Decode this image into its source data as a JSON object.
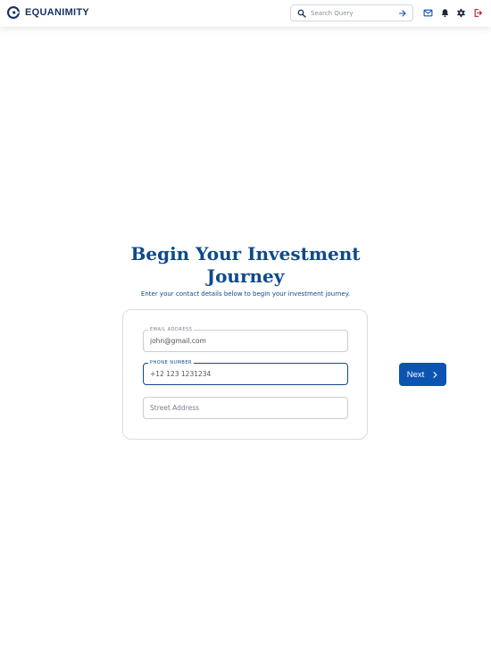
{
  "header": {
    "brand": "EQUANIMITY",
    "search": {
      "placeholder": "Search Query",
      "value": ""
    },
    "icons": [
      "mail-icon",
      "bell-icon",
      "gear-icon",
      "logout-icon"
    ]
  },
  "main": {
    "title": "Begin Your Investment Journey",
    "subtitle": "Enter your contact details below to begin your investment journey.",
    "form": {
      "email": {
        "label": "EMAIL ADDRESS",
        "value": "john@gmail.com"
      },
      "phone": {
        "label": "PHONE NUMBER",
        "value": "+12 123 1231234"
      },
      "address": {
        "placeholder": "Street Address",
        "value": ""
      }
    },
    "next_label": "Next"
  },
  "colors": {
    "primary": "#0b54b2",
    "title": "#0d4a8a",
    "logout": "#c8102e"
  }
}
